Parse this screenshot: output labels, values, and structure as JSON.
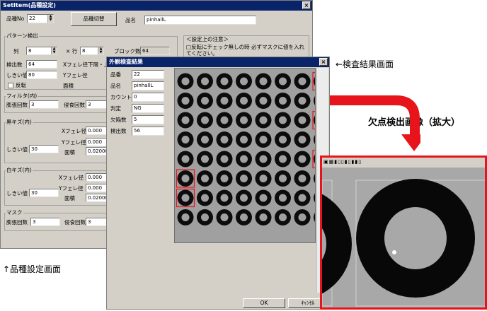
{
  "settem": {
    "title": "SetItem(品種設定)",
    "close": "×",
    "hinshu_label": "品種No",
    "hinshu_value": "22",
    "switch_button": "品種切替",
    "name_label": "品名",
    "name_value": "pinhallL",
    "pattern_group": "パターン検出",
    "col_label": "列",
    "col_value": "8",
    "row_label": "× 行",
    "row_value": "8",
    "block_label": "ブロック数",
    "block_value": "64",
    "detect_label": "検出数",
    "detect_value": "64",
    "xfere_label": "Xフェレ径下限・上限",
    "threshold_label": "しきい値",
    "threshold_value": "80",
    "yfere_label": "Yフェレ径",
    "invert_label": "反転",
    "area_label": "面積",
    "notes_title": "＜設定上の注意＞",
    "notes_text": "□反転にチェック無しの時  必ずマスクに値を入れてください。",
    "filter_group": "フィルタ(内)",
    "expand_label": "膨張回数",
    "expand_value": "3",
    "erode_label": "侵食回数",
    "erode_value": "3",
    "black_group": "黒キズ(内)",
    "black_xfere_label": "Xフェレ径",
    "black_xfere_value": "0.000",
    "black_yfere_label": "Yフェレ径",
    "black_yfere_value": "0.000",
    "black_thr_label": "しきい値",
    "black_thr_value": "30",
    "black_area_label": "面積",
    "black_area_value": "0.020000",
    "white_group": "白キズ(内)",
    "white_xfere_label": "Xフェレ径",
    "white_xfere_value": "0.000",
    "white_yfere_label": "Yフェレ径",
    "white_yfere_value": "0.000",
    "white_thr_label": "しきい値",
    "white_thr_value": "30",
    "white_area_label": "面積",
    "white_area_value": "0.020000",
    "mask_group": "マスク",
    "mask_expand_label": "膨張回数",
    "mask_expand_value": "3",
    "mask_erode_label": "侵食回数",
    "mask_erode_value": "3"
  },
  "result": {
    "title": "外観検査結果",
    "close": "×",
    "fields": [
      {
        "label": "品番",
        "value": "22"
      },
      {
        "label": "品名",
        "value": "pinhallL"
      },
      {
        "label": "カウント",
        "value": "0"
      },
      {
        "label": "判定",
        "value": "NG"
      },
      {
        "label": "欠陥数",
        "value": "5"
      },
      {
        "label": "検出数",
        "value": "56"
      }
    ],
    "ok_button": "OK",
    "cancel_button": "ｷｬﾝｾﾙ",
    "defects": [
      [
        0,
        7
      ],
      [
        2,
        7
      ],
      [
        4,
        7
      ],
      [
        5,
        0
      ],
      [
        6,
        0
      ]
    ]
  },
  "annotations": {
    "result_screen": "←検査結果画面",
    "zoom_title": "欠点検出画像（拡大）",
    "settings_screen": "↑品種設定画面"
  },
  "colors": {
    "accent_red": "#e8141c",
    "title_blue": "#0a246a"
  }
}
